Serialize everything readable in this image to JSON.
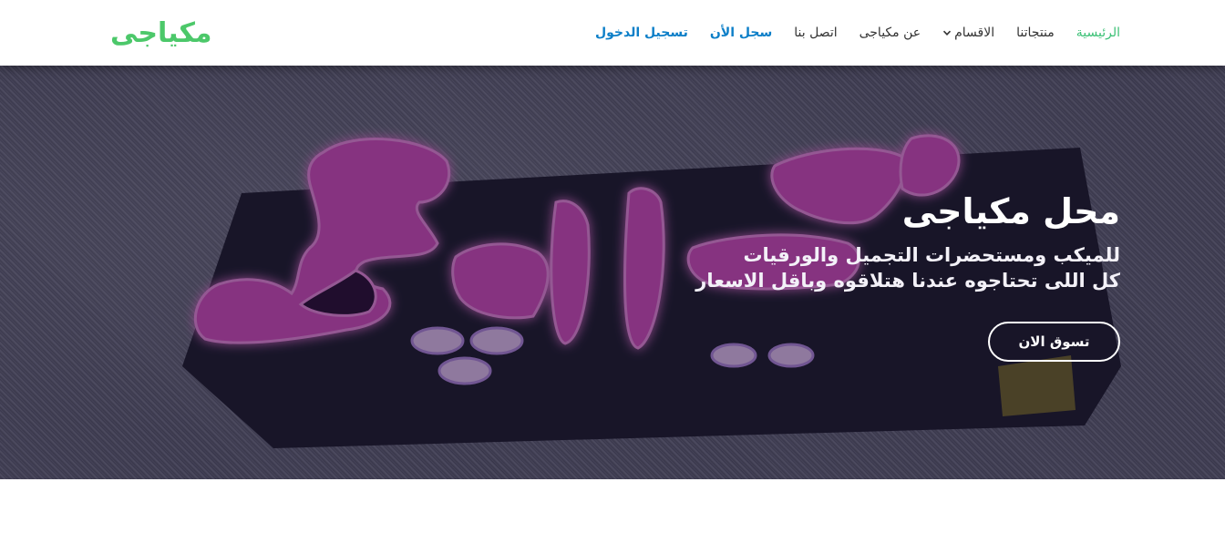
{
  "brand": {
    "name": "مكياجى",
    "color": "#4cc86a"
  },
  "nav": {
    "items": [
      {
        "label": "الرئيسية",
        "active": true
      },
      {
        "label": "منتجاتنا"
      },
      {
        "label": "الاقسام",
        "icon": "chevron-down-icon"
      },
      {
        "label": "عن مكياجى"
      },
      {
        "label": "اتصل بنا"
      },
      {
        "label": "سجل الأن"
      },
      {
        "label": "تسجيل الدخول"
      }
    ],
    "active_color": "#3cc176",
    "accent_color": "#0d7fc8"
  },
  "hero": {
    "title": "محل مكياجى",
    "subtitle_line1": "للميكب ومستحضرات التجميل والورقيات",
    "subtitle_line2": "كل اللى تحتاجوه عندنا هتلاقوه وباقل الاسعار",
    "cta_label": "تسوق الان",
    "image_description_color": "#e24fb6"
  }
}
